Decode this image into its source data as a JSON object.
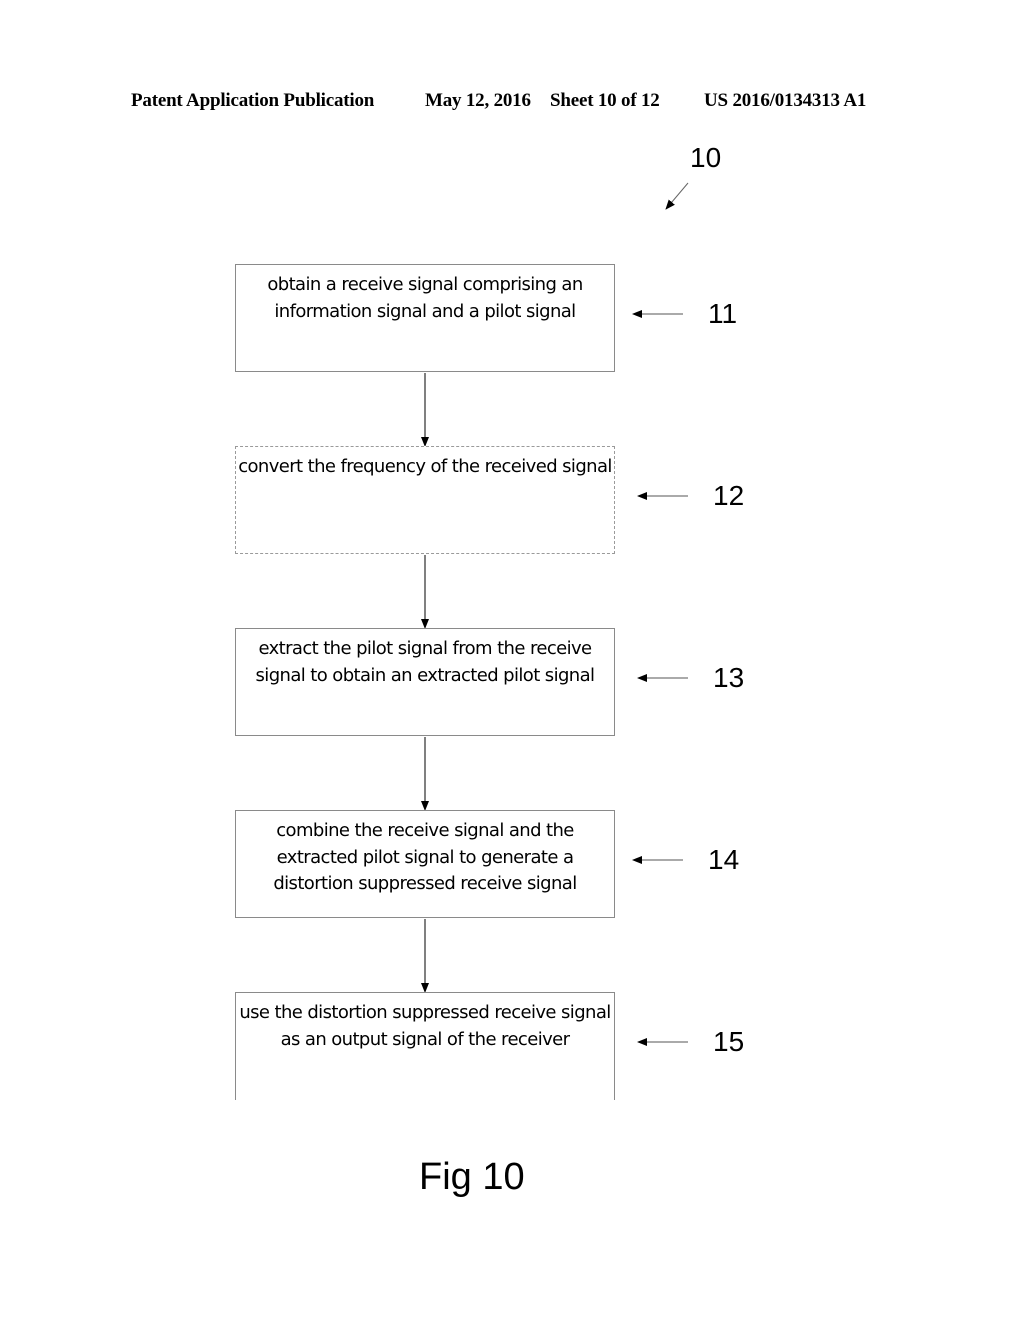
{
  "header": {
    "publication": "Patent Application Publication",
    "date": "May 12, 2016",
    "sheet": "Sheet 10 of 12",
    "number": "US 2016/0134313 A1"
  },
  "figure": {
    "reference": "10",
    "caption": "Fig 10",
    "steps": [
      {
        "ref": "11",
        "text": "obtain a receive signal comprising an information signal and a pilot signal",
        "style": "solid"
      },
      {
        "ref": "12",
        "text": "convert the frequency of the received signal",
        "style": "dashed"
      },
      {
        "ref": "13",
        "text": "extract the pilot signal from the receive signal to obtain an extracted pilot signal",
        "style": "solid"
      },
      {
        "ref": "14",
        "text": "combine the receive signal and the extracted pilot signal to generate a distortion suppressed receive signal",
        "style": "solid"
      },
      {
        "ref": "15",
        "text": "use the distortion suppressed receive signal as an output signal of the receiver",
        "style": "solid"
      }
    ]
  }
}
